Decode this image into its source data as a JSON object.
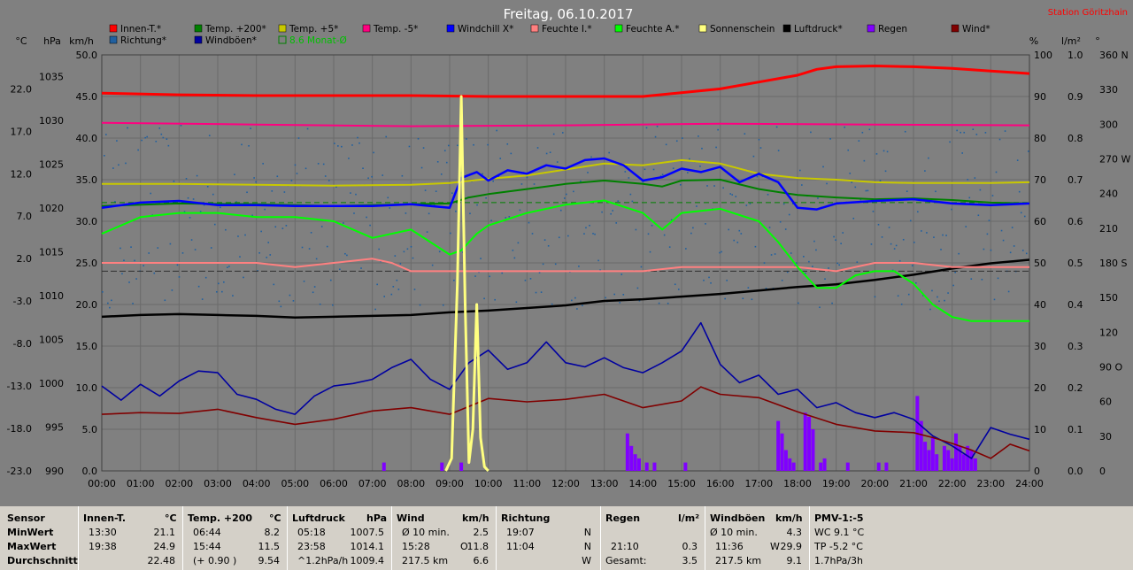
{
  "header": {
    "title": "Freitag, 06.10.2017",
    "station": "Station Göritzhain"
  },
  "legend": [
    {
      "label": "Innen-T.*",
      "color": "#ff0000"
    },
    {
      "label": "Temp. +200*",
      "color": "#008000"
    },
    {
      "label": "Temp. +5*",
      "color": "#c8c800"
    },
    {
      "label": "Temp. -5*",
      "color": "#ff0080"
    },
    {
      "label": "Windchill X*",
      "color": "#0000ff"
    },
    {
      "label": "Feuchte I.*",
      "color": "#ff8080"
    },
    {
      "label": "Feuchte A.*",
      "color": "#00ff00"
    },
    {
      "label": "Sonnenschein",
      "color": "#ffff80"
    },
    {
      "label": "Luftdruck*",
      "color": "#000000"
    },
    {
      "label": "Regen",
      "color": "#8000ff"
    },
    {
      "label": "Wind*",
      "color": "#800000"
    },
    {
      "label": "Richtung*",
      "color": "#2060a0"
    },
    {
      "label": "Windböen*",
      "color": "#0000a0"
    },
    {
      "label": "8.6 Monat-Ø",
      "color": "#008000"
    }
  ],
  "axis_units": {
    "celsius": "°C",
    "hpa": "hPa",
    "kmh": "km/h",
    "percent": "%",
    "rain": "l/m²",
    "degree": "°"
  },
  "chart_data": {
    "type": "line",
    "x_ticks": [
      "00:00",
      "01:00",
      "02:00",
      "03:00",
      "04:00",
      "05:00",
      "06:00",
      "07:00",
      "08:00",
      "09:00",
      "10:00",
      "11:00",
      "12:00",
      "13:00",
      "14:00",
      "15:00",
      "16:00",
      "17:00",
      "18:00",
      "19:00",
      "20:00",
      "21:00",
      "22:00",
      "23:00",
      "24:00"
    ],
    "xlim_hours": [
      0,
      24
    ],
    "axes": {
      "celsius": {
        "ticks": [
          "22.0",
          "17.0",
          "12.0",
          "7.0",
          "2.0",
          "-3.0",
          "-8.0",
          "-13.0",
          "-18.0",
          "-23.0"
        ],
        "range": [
          -23,
          26
        ]
      },
      "hpa": {
        "ticks": [
          "1035",
          "1030",
          "1025",
          "1020",
          "1015",
          "1010",
          "1005",
          "1000",
          "995",
          "990"
        ],
        "range": [
          990,
          1037.5
        ]
      },
      "kmh": {
        "ticks": [
          "50.0",
          "45.0",
          "40.0",
          "35.0",
          "30.0",
          "25.0",
          "20.0",
          "15.0",
          "10.0",
          "5.0",
          "0.0"
        ],
        "range": [
          0,
          50
        ]
      },
      "percent": {
        "ticks": [
          "100",
          "90",
          "80",
          "70",
          "60",
          "50",
          "40",
          "30",
          "20",
          "10",
          "0"
        ],
        "range": [
          0,
          100
        ]
      },
      "rain": {
        "ticks": [
          "1.0",
          "0.9",
          "0.8",
          "0.7",
          "0.6",
          "0.5",
          "0.4",
          "0.3",
          "0.2",
          "0.1",
          "0.0"
        ],
        "range": [
          0,
          1
        ]
      },
      "degree": {
        "ticks": [
          "360 N",
          "330",
          "300",
          "270 W",
          "240",
          "210",
          "180 S",
          "150",
          "120",
          "90 O",
          "60",
          "30",
          "0"
        ],
        "range": [
          0,
          360
        ]
      }
    },
    "series": [
      {
        "name": "Innen-T.*",
        "axis": "celsius",
        "x": [
          0,
          2,
          4,
          6,
          8,
          10,
          12,
          14,
          16,
          17,
          18,
          18.5,
          19,
          20,
          21,
          22,
          23,
          24
        ],
        "y": [
          21.5,
          21.3,
          21.2,
          21.2,
          21.2,
          21.1,
          21.1,
          21.1,
          22.0,
          22.8,
          23.6,
          24.3,
          24.6,
          24.7,
          24.6,
          24.4,
          24.1,
          23.8
        ]
      },
      {
        "name": "Temp. +200*",
        "axis": "celsius",
        "x": [
          0,
          2,
          4,
          6,
          8,
          9,
          9.5,
          10,
          11,
          12,
          13,
          14,
          14.5,
          15,
          16,
          17,
          18,
          19,
          20,
          21,
          22,
          23,
          24
        ],
        "y": [
          8.2,
          8.5,
          8.4,
          8.2,
          8.4,
          8.5,
          9.2,
          9.6,
          10.2,
          10.8,
          11.2,
          10.8,
          10.5,
          11.2,
          11.3,
          10.2,
          9.5,
          9.2,
          9.0,
          9.1,
          8.9,
          8.6,
          8.5
        ]
      },
      {
        "name": "Temp. +5*",
        "axis": "celsius",
        "x": [
          0,
          2,
          4,
          6,
          8,
          9,
          10,
          11,
          12,
          13,
          14,
          15,
          16,
          17,
          18,
          19,
          20,
          21,
          22,
          23,
          24
        ],
        "y": [
          10.8,
          10.8,
          10.7,
          10.6,
          10.7,
          10.9,
          11.4,
          11.8,
          12.5,
          13.2,
          13.0,
          13.6,
          13.2,
          12.0,
          11.5,
          11.3,
          11.0,
          10.9,
          10.9,
          10.9,
          11.0
        ]
      },
      {
        "name": "Temp. -5*",
        "axis": "celsius",
        "x": [
          0,
          4,
          8,
          12,
          16,
          20,
          24
        ],
        "y": [
          18.0,
          17.8,
          17.6,
          17.7,
          17.9,
          17.8,
          17.7
        ]
      },
      {
        "name": "Windchill X*",
        "axis": "celsius",
        "x": [
          0,
          1,
          2,
          3,
          4,
          5,
          6,
          7,
          8,
          9,
          9.3,
          9.7,
          10,
          10.5,
          11,
          11.5,
          12,
          12.5,
          13,
          13.5,
          14,
          14.5,
          15,
          15.5,
          16,
          16.5,
          17,
          17.5,
          18,
          18.5,
          19,
          20,
          21,
          22,
          23,
          24
        ],
        "y": [
          8.0,
          8.6,
          8.8,
          8.3,
          8.3,
          8.2,
          8.2,
          8.2,
          8.4,
          8.0,
          11.5,
          12.2,
          11.2,
          12.4,
          12.0,
          13.0,
          12.6,
          13.6,
          13.8,
          13.0,
          11.2,
          11.6,
          12.6,
          12.2,
          12.8,
          11.0,
          12.0,
          11.0,
          8.0,
          7.8,
          8.5,
          8.8,
          9.0,
          8.5,
          8.3,
          8.5
        ]
      },
      {
        "name": "Feuchte I.*",
        "axis": "percent",
        "x": [
          0,
          2,
          4,
          5,
          6,
          7,
          7.5,
          8,
          9,
          10,
          12,
          14,
          15,
          16,
          17,
          18,
          19,
          20,
          21,
          22,
          23,
          24
        ],
        "y": [
          50,
          50,
          50,
          49,
          50,
          51,
          50,
          48,
          48,
          48,
          48,
          48,
          49,
          49,
          49,
          49,
          48,
          50,
          50,
          49,
          49,
          49
        ]
      },
      {
        "name": "Feuchte A.*",
        "axis": "percent",
        "x": [
          0,
          1,
          2,
          3,
          4,
          5,
          6,
          7,
          8,
          9,
          9.3,
          9.7,
          10,
          11,
          12,
          13,
          14,
          14.5,
          15,
          16,
          17,
          17.5,
          18,
          18.5,
          19,
          19.5,
          20,
          20.5,
          21,
          21.5,
          22,
          22.5,
          23,
          24
        ],
        "y": [
          57,
          61,
          62,
          62,
          61,
          61,
          60,
          56,
          58,
          52,
          53,
          57,
          59,
          62,
          64,
          65,
          62,
          58,
          62,
          63,
          60,
          55,
          49,
          44,
          44,
          47,
          48,
          48,
          45,
          40,
          37,
          36,
          36,
          36
        ]
      },
      {
        "name": "Luftdruck*",
        "axis": "hpa",
        "x": [
          0,
          1,
          2,
          3,
          4,
          5,
          6,
          7,
          8,
          9,
          10,
          11,
          12,
          13,
          14,
          15,
          16,
          17,
          18,
          19,
          20,
          21,
          22,
          23,
          24
        ],
        "y": [
          1007.6,
          1007.8,
          1007.9,
          1007.8,
          1007.7,
          1007.5,
          1007.6,
          1007.7,
          1007.8,
          1008.1,
          1008.3,
          1008.6,
          1008.9,
          1009.4,
          1009.6,
          1009.9,
          1010.2,
          1010.6,
          1011.0,
          1011.3,
          1011.8,
          1012.4,
          1013.1,
          1013.7,
          1014.1
        ]
      },
      {
        "name": "Wind*",
        "axis": "kmh",
        "x": [
          0,
          1,
          2,
          3,
          4,
          5,
          6,
          7,
          8,
          9,
          10,
          11,
          12,
          13,
          14,
          15,
          15.5,
          16,
          17,
          18,
          19,
          20,
          21,
          21.5,
          22,
          22.5,
          23,
          23.5,
          24
        ],
        "y": [
          6.8,
          7.0,
          6.9,
          7.4,
          6.4,
          5.6,
          6.2,
          7.2,
          7.6,
          6.8,
          8.7,
          8.3,
          8.6,
          9.2,
          7.6,
          8.4,
          10.1,
          9.2,
          8.8,
          7.1,
          5.6,
          4.8,
          4.6,
          4.0,
          3.3,
          2.5,
          1.5,
          3.2,
          2.4
        ]
      },
      {
        "name": "Windböen*",
        "axis": "kmh",
        "x": [
          0,
          0.5,
          1,
          1.5,
          2,
          2.5,
          3,
          3.5,
          4,
          4.5,
          5,
          5.5,
          6,
          6.5,
          7,
          7.5,
          8,
          8.5,
          9,
          9.5,
          10,
          10.5,
          11,
          11.5,
          12,
          12.5,
          13,
          13.5,
          14,
          14.5,
          15,
          15.5,
          16,
          16.5,
          17,
          17.5,
          18,
          18.5,
          19,
          19.5,
          20,
          20.5,
          21,
          21.5,
          22,
          22.5,
          23,
          23.5,
          24
        ],
        "y": [
          10.2,
          8.5,
          10.4,
          9.0,
          10.8,
          12.0,
          11.8,
          9.2,
          8.6,
          7.4,
          6.8,
          9.0,
          10.2,
          10.5,
          11.0,
          12.4,
          13.4,
          11.0,
          9.8,
          13.0,
          14.5,
          12.2,
          13.0,
          15.5,
          13.0,
          12.5,
          13.6,
          12.4,
          11.8,
          13.0,
          14.4,
          17.8,
          12.8,
          10.6,
          11.5,
          9.2,
          9.8,
          7.6,
          8.2,
          7.0,
          6.4,
          7.0,
          6.2,
          4.2,
          3.0,
          1.5,
          5.2,
          4.4,
          3.8
        ]
      },
      {
        "name": "Sonnenschein",
        "axis": "percent",
        "x": [
          8.9,
          9.05,
          9.2,
          9.3,
          9.4,
          9.5,
          9.6,
          9.7,
          9.8,
          9.9,
          10.0
        ],
        "y": [
          0,
          3,
          45,
          90,
          40,
          2,
          10,
          40,
          8,
          1,
          0
        ]
      },
      {
        "name": "Regen",
        "axis": "rain",
        "type": "bar",
        "x": [
          7.3,
          8.8,
          9.3,
          13.6,
          13.7,
          13.8,
          13.9,
          14.1,
          14.3,
          15.1,
          17.5,
          17.6,
          17.7,
          17.8,
          17.9,
          18.2,
          18.3,
          18.4,
          18.6,
          18.7,
          19.3,
          20.1,
          20.3,
          21.1,
          21.2,
          21.3,
          21.4,
          21.5,
          21.6,
          21.8,
          21.9,
          22.0,
          22.1,
          22.2,
          22.3,
          22.4,
          22.5,
          22.6
        ],
        "y": [
          0.02,
          0.02,
          0.02,
          0.09,
          0.06,
          0.04,
          0.03,
          0.02,
          0.02,
          0.02,
          0.12,
          0.09,
          0.05,
          0.03,
          0.02,
          0.14,
          0.13,
          0.1,
          0.02,
          0.03,
          0.02,
          0.02,
          0.02,
          0.18,
          0.12,
          0.07,
          0.05,
          0.08,
          0.04,
          0.06,
          0.05,
          0.03,
          0.09,
          0.06,
          0.04,
          0.06,
          0.05,
          0.03
        ]
      },
      {
        "name": "8.6 Monat-Ø",
        "axis": "celsius",
        "x": [
          0,
          24
        ],
        "y": [
          8.6,
          8.6
        ]
      },
      {
        "name": "Richtung*",
        "axis": "degree",
        "type": "scatter",
        "note_range": [
          140,
          300
        ]
      }
    ],
    "grid": true,
    "legend_position": "top"
  },
  "stats": {
    "row_labels": [
      "Sensor",
      "MinWert",
      "MaxWert",
      "Durchschnitt"
    ],
    "innen": {
      "title": "Innen-T.",
      "unit": "°C",
      "min_time": "13:30",
      "min": "21.1",
      "max_time": "19:38",
      "max": "24.9",
      "avg": "22.48"
    },
    "temp200": {
      "title": "Temp. +200",
      "unit": "°C",
      "min_time": "06:44",
      "min": "8.2",
      "max_time": "15:44",
      "max": "11.5",
      "avg_note": "(+ 0.90 )",
      "avg": "9.54"
    },
    "druck": {
      "title": "Luftdruck",
      "unit": "hPa",
      "min_time": "05:18",
      "min": "1007.5",
      "max_time": "23:58",
      "max": "1014.1",
      "avg_note": "^1.2hPa/h",
      "avg": "1009.4"
    },
    "wind": {
      "title": "Wind",
      "unit": "km/h",
      "min_label": "Ø 10 min.",
      "min": "2.5",
      "max_time": "15:28",
      "max_dir": "O",
      "max": "11.8",
      "avg_note": "217.5 km",
      "avg": "6.6"
    },
    "richtung": {
      "title": "Richtung",
      "min_time": "19:07",
      "min": "N",
      "max_time": "11:04",
      "max": "N",
      "avg": "W"
    },
    "regen": {
      "title": "Regen",
      "unit": "l/m²",
      "max_time": "21:10",
      "max": "0.3",
      "avg_label": "Gesamt:",
      "avg": "3.5"
    },
    "boeen": {
      "title": "Windböen",
      "unit": "km/h",
      "min_label": "Ø 10 min.",
      "min": "4.3",
      "max_time": "11:36",
      "max_dir": "W",
      "max": "29.9",
      "avg_note": "217.5 km",
      "avg": "9.1"
    },
    "pmv": {
      "title": "PMV-1:-5",
      "min": "WC 9.1 °C",
      "max": "TP -5.2 °C",
      "avg": "1.7hPa/3h"
    }
  }
}
